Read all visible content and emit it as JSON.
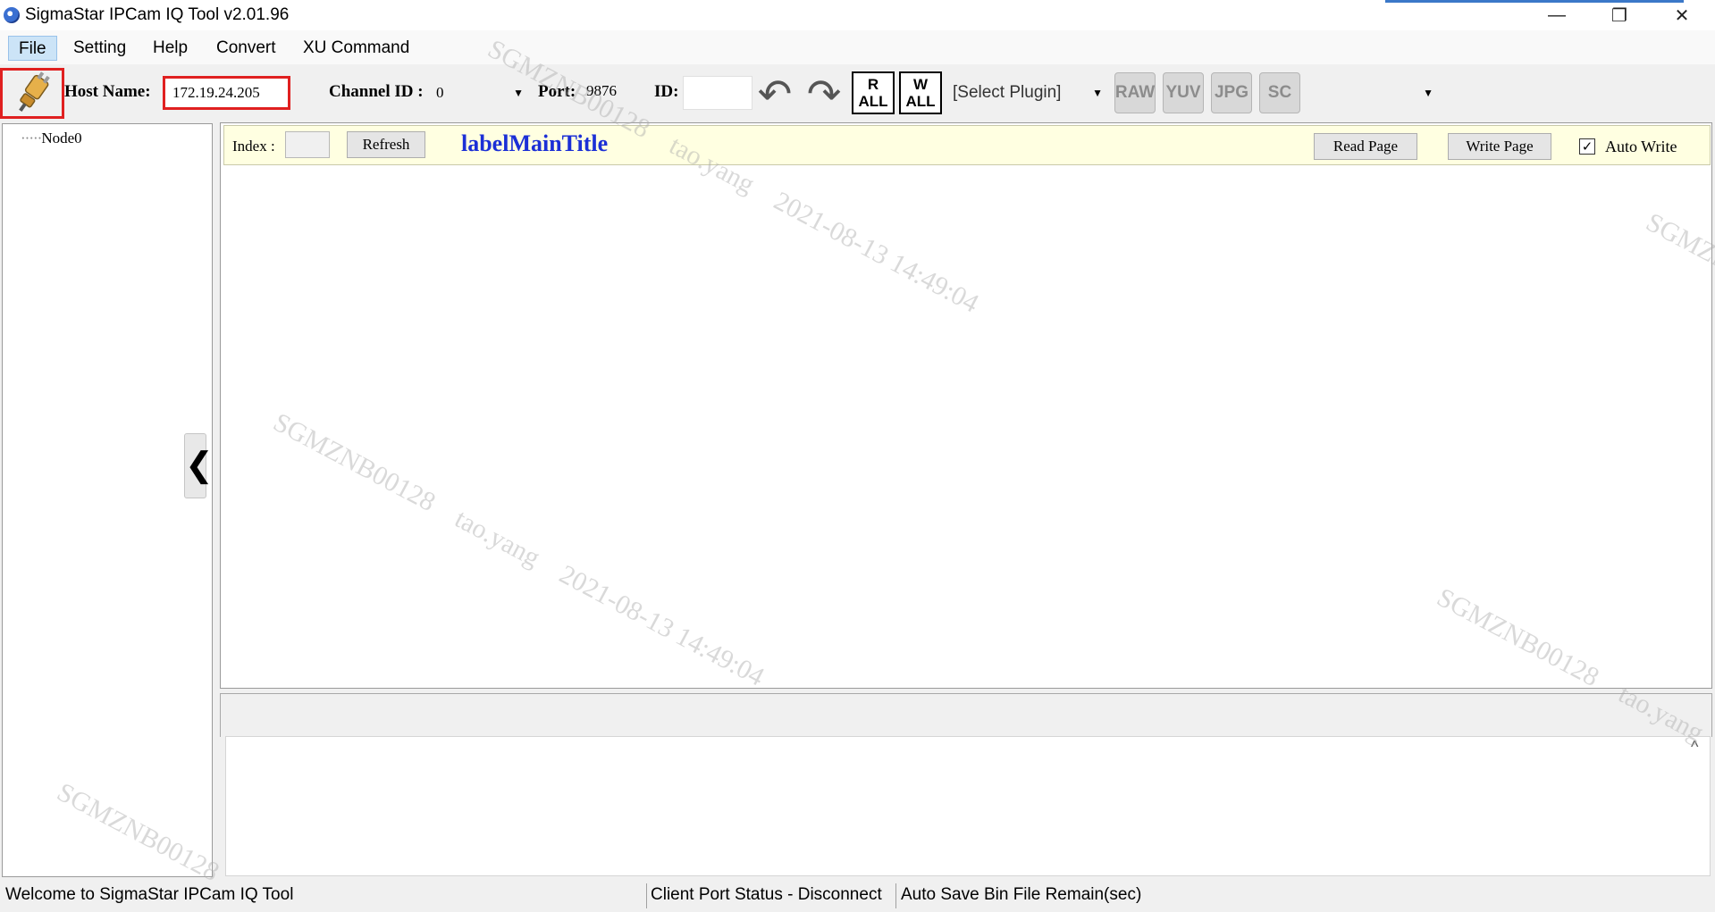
{
  "window": {
    "title": "SigmaStar IPCam IQ Tool v2.01.96",
    "controls": {
      "minimize": "—",
      "restore": "❐",
      "close": "✕"
    }
  },
  "menu": [
    "File",
    "Setting",
    "Help",
    "Convert",
    "XU Command"
  ],
  "toolbar": {
    "host_label": "Host Name:",
    "host_value": "172.19.24.205",
    "channel_label": "Channel ID :",
    "channel_value": "0",
    "port_label": "Port:",
    "port_value": "9876",
    "id_label": "ID:",
    "id_value": "",
    "undo_glyph": "↶",
    "redo_glyph": "↷",
    "read_all": {
      "top": "R",
      "bottom": "ALL"
    },
    "write_all": {
      "top": "W",
      "bottom": "ALL"
    },
    "plugin_value": "[Select Plugin]",
    "icons": [
      "RAW",
      "YUV",
      "JPG",
      "SC"
    ],
    "extra_select_value": ""
  },
  "tree": {
    "nodes": [
      "Node0"
    ],
    "collapse_glyph": "❮"
  },
  "header": {
    "index_label": "Index :",
    "index_value": "",
    "refresh_label": "Refresh",
    "main_title": "labelMainTitle",
    "read_page_label": "Read Page",
    "write_page_label": "Write Page",
    "auto_write_label": "Auto Write",
    "auto_write_checked": true
  },
  "output": {
    "scroll_glyph": "^"
  },
  "status": {
    "welcome": "Welcome to SigmaStar IPCam IQ Tool",
    "client_port": "Client Port Status - Disconnect",
    "auto_save": "Auto Save Bin File Remain(sec)"
  },
  "watermark": {
    "user_code": "SGMZNB00128",
    "user_name": "tao.yang",
    "datetime": "2021-08-13 14:49:04"
  },
  "colors": {
    "highlight_red": "#e02020",
    "title_blue": "#1b2fd6",
    "header_yellow": "#ffffe1",
    "menu_active": "#cce4f7"
  }
}
